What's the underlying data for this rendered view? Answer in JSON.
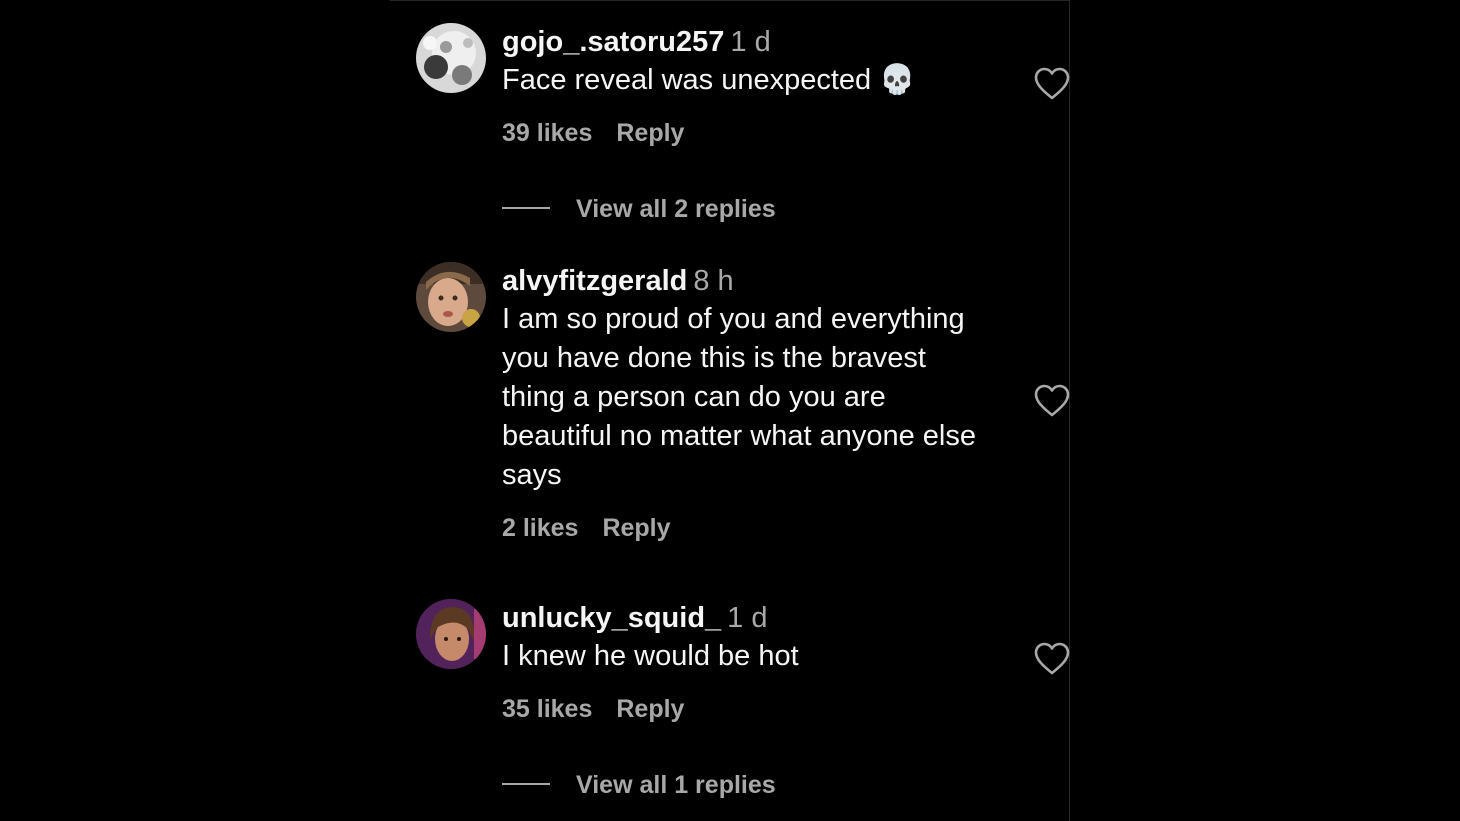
{
  "comments": [
    {
      "username": "gojo_.satoru257",
      "time": "1 d",
      "text": "Face reveal was unexpected 💀",
      "likes": "39 likes",
      "reply_label": "Reply",
      "view_replies": "View all 2 replies"
    },
    {
      "username": "alvyfitzgerald",
      "time": "8 h",
      "text_lines": [
        "I am so proud of you and everything",
        "you have done this is the bravest",
        "thing a person can do you are",
        "beautiful no matter what anyone else",
        "says"
      ],
      "likes": "2 likes",
      "reply_label": "Reply"
    },
    {
      "username": "unlucky_squid_",
      "time": "1 d",
      "text": "I knew he would be hot",
      "likes": "35 likes",
      "reply_label": "Reply",
      "view_replies": "View all 1 replies"
    }
  ],
  "colors": {
    "background": "#000000",
    "primary_text": "#f5f5f5",
    "secondary_text": "#a8a8a8"
  },
  "icons": {
    "like": "heart-outline-icon"
  }
}
